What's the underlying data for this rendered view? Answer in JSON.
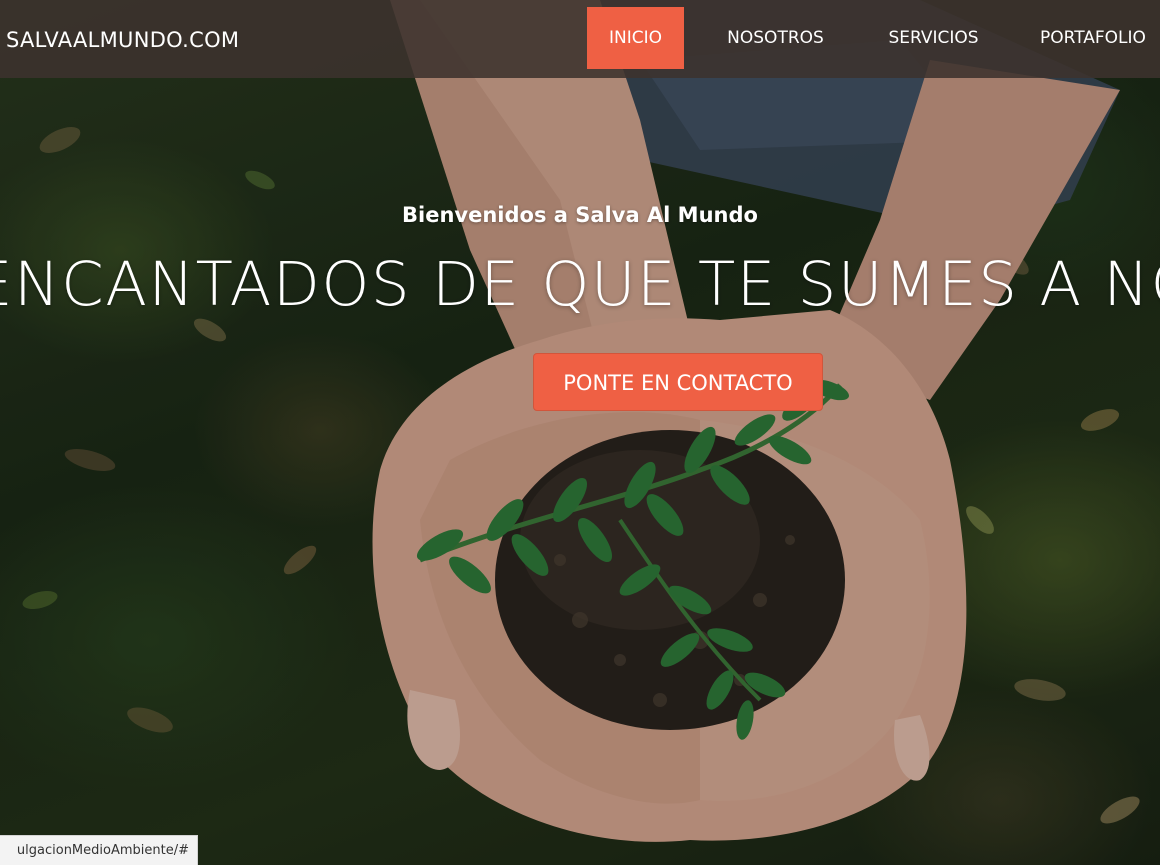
{
  "navbar": {
    "brand": "SALVAALMUNDO.COM",
    "items": [
      {
        "label": "INICIO",
        "active": true
      },
      {
        "label": "NOSOTROS",
        "active": false
      },
      {
        "label": "SERVICIOS",
        "active": false
      },
      {
        "label": "PORTAFOLIO",
        "active": false
      }
    ]
  },
  "hero": {
    "welcome": "Bienvenidos a Salva Al Mundo",
    "headline": "ENCANTADOS DE QUE TE SUMES A NOSOTROS",
    "cta_label": "PONTE EN CONTACTO"
  },
  "status_bar": {
    "url": "ulgacionMedioAmbiente/#"
  },
  "colors": {
    "accent": "#ef6044",
    "navbar_bg": "#3c322d",
    "text": "#ffffff"
  }
}
